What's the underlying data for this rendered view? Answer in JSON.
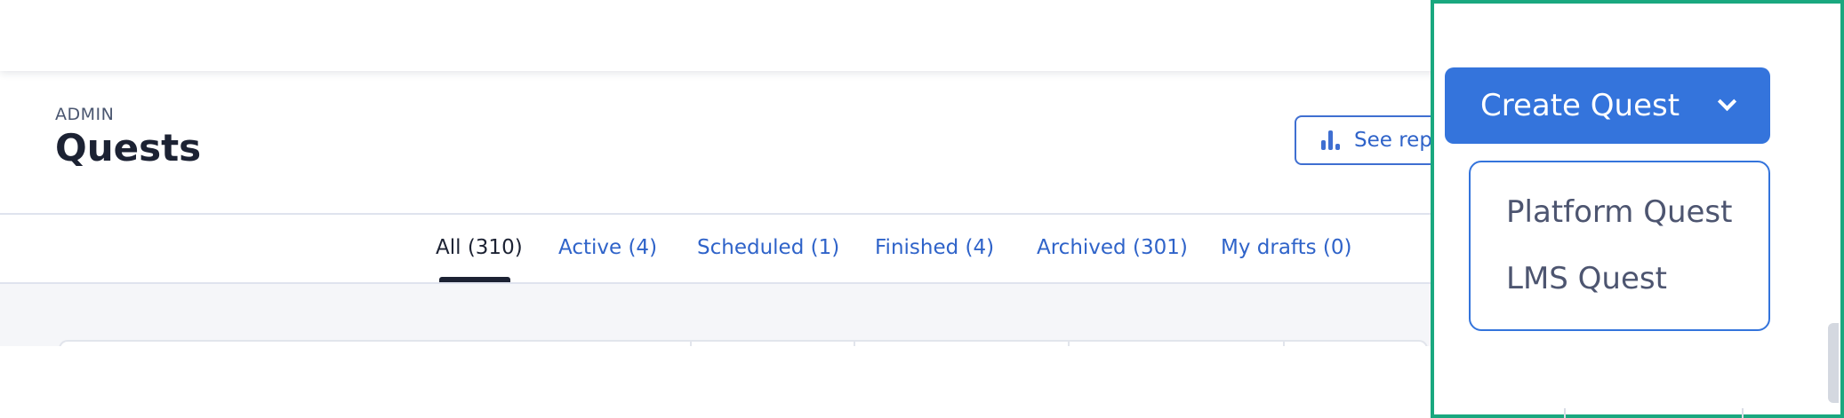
{
  "header": {
    "overline": "ADMIN",
    "title": "Quests",
    "report_button_label": "See reports"
  },
  "tabs": [
    {
      "label": "All (310)",
      "active": true
    },
    {
      "label": "Active (4)",
      "active": false
    },
    {
      "label": "Scheduled (1)",
      "active": false
    },
    {
      "label": "Finished (4)",
      "active": false
    },
    {
      "label": "Archived (301)",
      "active": false
    },
    {
      "label": "My drafts (0)",
      "active": false
    }
  ],
  "create_quest": {
    "label": "Create Quest",
    "icon": "chevron-down-icon",
    "menu": [
      {
        "label": "Platform Quest"
      },
      {
        "label": "LMS Quest"
      }
    ]
  },
  "colors": {
    "primary": "#3474dc",
    "link": "#2f63c9",
    "text_dark": "#1c2233",
    "highlight_frame": "#1aa87f"
  }
}
